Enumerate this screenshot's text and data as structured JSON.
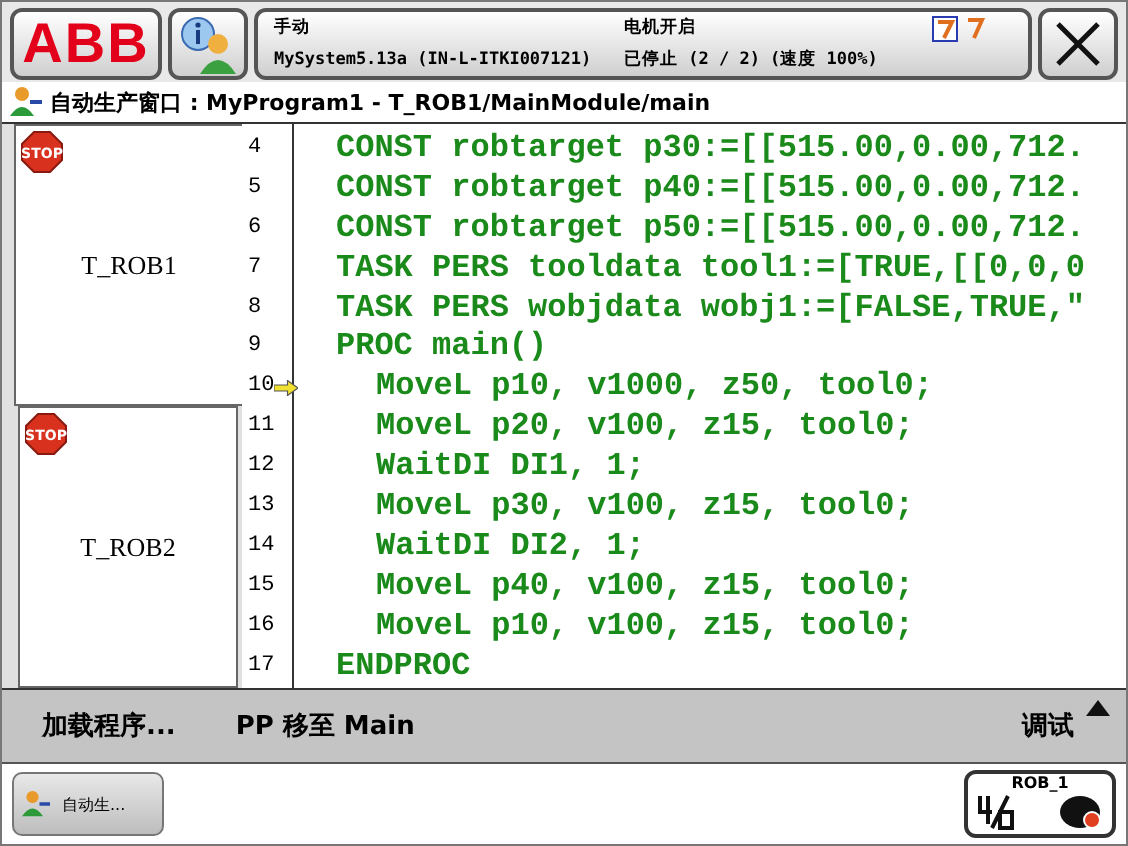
{
  "header": {
    "logo": "ABB",
    "mode": "手动",
    "system": "MySystem5.13a (IN-L-ITKI007121)",
    "motor": "电机开启",
    "state": "已停止 (2 / 2) (速度 100%)"
  },
  "path_bar": {
    "title": "自动生产窗口 : MyProgram1 - T_ROB1/MainModule/main"
  },
  "tasks": [
    {
      "name": "T_ROB1",
      "badge": "STOP",
      "selected": true
    },
    {
      "name": "T_ROB2",
      "badge": "STOP",
      "selected": false
    }
  ],
  "code_lines": [
    {
      "number": "4",
      "text": "CONST robtarget p30:=[[515.00,0.00,712.",
      "pointer": false
    },
    {
      "number": "5",
      "text": "CONST robtarget p40:=[[515.00,0.00,712.",
      "pointer": false
    },
    {
      "number": "6",
      "text": "CONST robtarget p50:=[[515.00,0.00,712.",
      "pointer": false
    },
    {
      "number": "7",
      "text": "TASK PERS tooldata tool1:=[TRUE,[[0,0,0",
      "pointer": false
    },
    {
      "number": "8",
      "text": "TASK PERS wobjdata wobj1:=[FALSE,TRUE,\"",
      "pointer": false
    },
    {
      "number": "9",
      "text": "PROC main()",
      "pointer": false,
      "children": [
        {
          "number": "10",
          "text": "MoveL p10, v1000, z50, tool0;",
          "pointer": true
        },
        {
          "number": "11",
          "text": "MoveL p20, v100, z15, tool0;",
          "pointer": false
        },
        {
          "number": "12",
          "text": "WaitDI DI1, 1;",
          "pointer": false
        },
        {
          "number": "13",
          "text": "MoveL p30, v100, z15, tool0;",
          "pointer": false
        },
        {
          "number": "14",
          "text": "WaitDI DI2, 1;",
          "pointer": false
        },
        {
          "number": "15",
          "text": "MoveL p40, v100, z15, tool0;",
          "pointer": false
        },
        {
          "number": "16",
          "text": "MoveL p10, v100, z15, tool0;",
          "pointer": false
        }
      ]
    },
    {
      "number": "17",
      "text": "ENDPROC",
      "pointer": false
    }
  ],
  "menu_bar": {
    "items": [
      "加载程序...",
      "PP 移至 Main"
    ],
    "right_item": "调试"
  },
  "taskbar": {
    "window_button": "自动生...",
    "robot_button": "ROB_1"
  }
}
